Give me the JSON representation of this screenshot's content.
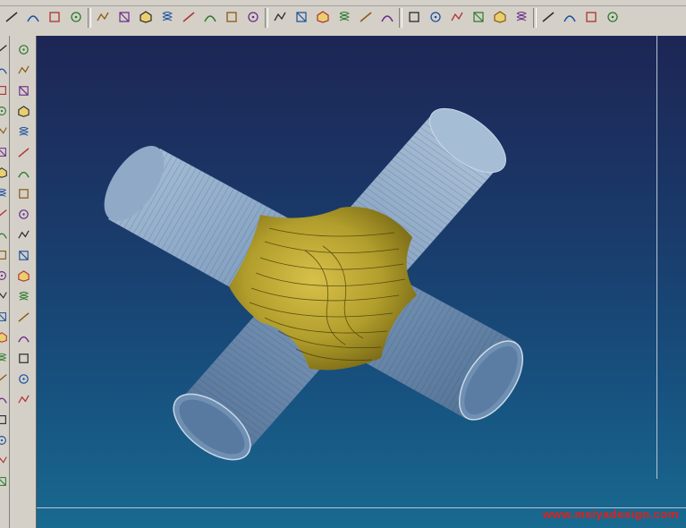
{
  "app": {
    "accent_color": "#d4d0c8",
    "viewport_gradient": [
      "#1d2655",
      "#186a90"
    ]
  },
  "top_toolbar": {
    "buttons": [
      {
        "icon": "line-tool-icon"
      },
      {
        "icon": "arc-tool-icon"
      },
      {
        "icon": "polygon-tool-icon"
      },
      {
        "icon": "curve-tool-icon"
      },
      {
        "icon": "point-tool-icon"
      },
      {
        "icon": "polyline-tool-icon"
      },
      {
        "icon": "spline-tool-icon"
      },
      {
        "icon": "rectangle-tool-icon"
      },
      {
        "icon": "circle-tool-icon"
      },
      {
        "icon": "ellipse-tool-icon"
      },
      {
        "icon": "spiral-tool-icon"
      },
      {
        "icon": "spring-tool-icon"
      },
      {
        "icon": "mirror-tool-icon"
      },
      {
        "icon": "offset-tool-icon"
      },
      {
        "icon": "transform-tool-icon"
      },
      {
        "icon": "array-tool-icon"
      },
      {
        "icon": "trim-tool-icon"
      },
      {
        "icon": "extend-tool-icon"
      },
      {
        "icon": "solid-tool-icon"
      },
      {
        "icon": "mesh-tool-icon"
      },
      {
        "icon": "blend-tool-icon"
      },
      {
        "icon": "analyze-tool-icon"
      },
      {
        "icon": "color-tool-icon"
      },
      {
        "icon": "render-tool-icon"
      },
      {
        "icon": "layers-tool-icon"
      },
      {
        "icon": "surface-edit-icon"
      },
      {
        "icon": "measure-tool-icon"
      },
      {
        "icon": "undo-view-icon"
      }
    ]
  },
  "left_toolbar": {
    "buttons": [
      {
        "icon": "wireframe-box-icon"
      },
      {
        "icon": "solid-box-icon"
      },
      {
        "icon": "extrude-icon"
      },
      {
        "icon": "revolve-icon"
      },
      {
        "icon": "sweep-icon"
      },
      {
        "icon": "loft-icon"
      },
      {
        "icon": "shell-icon"
      },
      {
        "icon": "pattern-icon"
      },
      {
        "icon": "boolean-icon"
      },
      {
        "icon": "fillet-icon"
      },
      {
        "icon": "chamfer-icon"
      },
      {
        "icon": "draft-icon"
      },
      {
        "icon": "split-icon"
      },
      {
        "icon": "combine-icon"
      },
      {
        "icon": "thicken-icon"
      },
      {
        "icon": "paint-face-icon"
      },
      {
        "icon": "paint-body-icon"
      },
      {
        "icon": "query-icon"
      }
    ]
  },
  "viewport": {
    "model": "pipe-cross-junction",
    "watermark": "www.meiyadesign.com"
  }
}
